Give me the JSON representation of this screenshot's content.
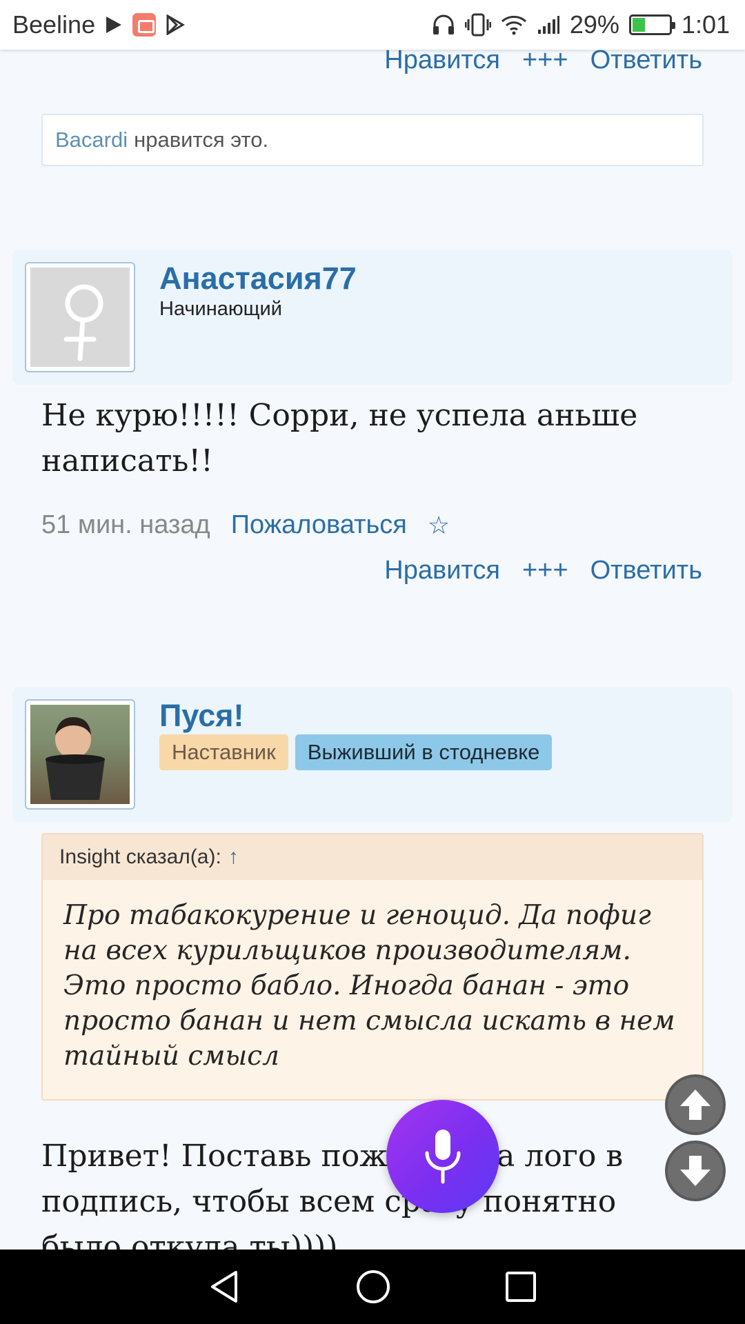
{
  "status_bar": {
    "carrier": "Beeline",
    "battery": "29%",
    "time": "1:01",
    "icons": [
      "play-icon",
      "app-notification-icon",
      "play-store-icon",
      "headphones-icon",
      "vibrate-icon",
      "wifi-icon",
      "signal-icon",
      "battery-icon"
    ]
  },
  "actions": {
    "like": "Нравится",
    "plus": "+++",
    "reply": "Ответить"
  },
  "likes_box": {
    "user": "Bacardi",
    "text": "нравится это."
  },
  "post1": {
    "username": "Анастасия77",
    "rank": "Начинающий",
    "text": "Не курю!!!!! Сорри, не успела аньше написать!!",
    "time": "51 мин. назад",
    "report": "Пожаловаться",
    "star": "☆"
  },
  "post2": {
    "username": "Пуся!",
    "badges": [
      "Наставник",
      "Выживший в стодневке"
    ],
    "quote_header": "Insight сказал(а):",
    "quote_arrow": "↑",
    "quote_text": "Про табакокурение и геноцид. Да пофиг на всех курильщиков производителям. Это просто бабло. Иногда банан - это просто банан и нет смысла искать в нем тайный смысл",
    "text": "Привет! Поставь пожалуйста лого в подпись, чтобы всем сразу понятно было откуда ты))))"
  },
  "colors": {
    "link": "#2a6ea8",
    "header_bg": "#ecf5fb",
    "quote_bg": "#fdf3e6",
    "mic_gradient": [
      "#a335f0",
      "#5b3af5"
    ]
  }
}
